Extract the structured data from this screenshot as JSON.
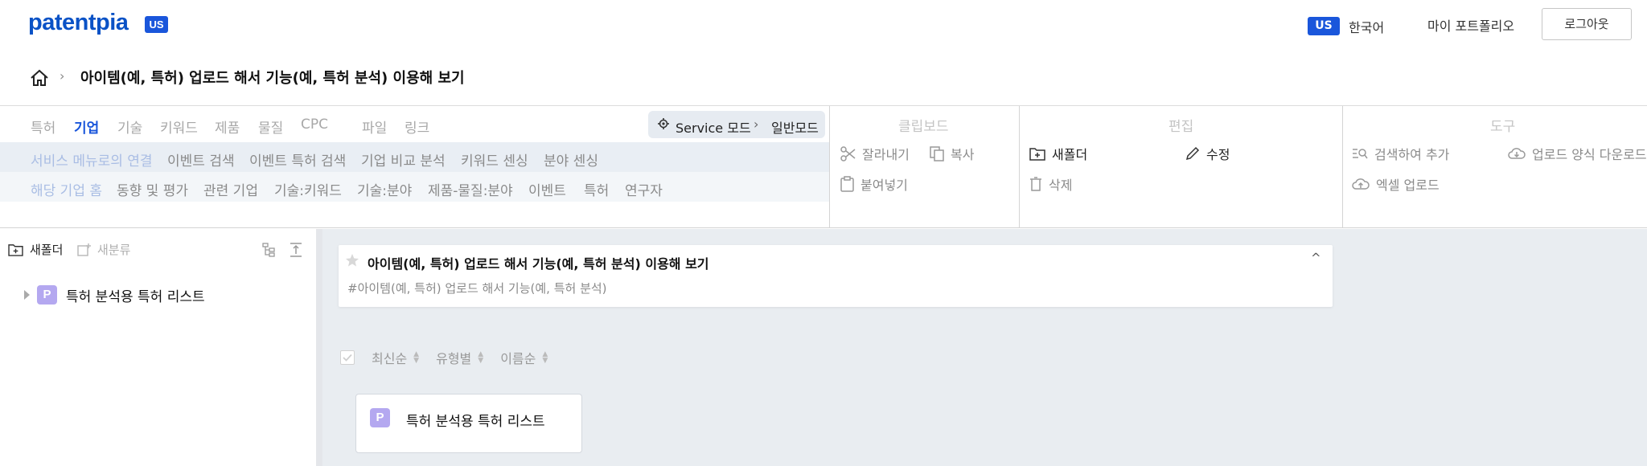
{
  "header": {
    "logo": "patentpia",
    "logo_badge": "US",
    "lang_badge": "US",
    "lang_label": "한국어",
    "portfolio": "마이 포트폴리오",
    "logout": "로그아웃"
  },
  "breadcrumb": {
    "title": "아이템(예, 특허) 업로드 해서 기능(예, 특허 분석) 이용해 보기"
  },
  "ribbon": {
    "categories": [
      "특허",
      "기업",
      "기술",
      "키워드",
      "제품",
      "물질",
      "CPC",
      "파일",
      "링크"
    ],
    "mode": {
      "service": "Service 모드",
      "normal": "일반모드"
    },
    "row2": [
      "서비스 메뉴로의 연결",
      "이벤트 검색",
      "이벤트 특허 검색",
      "기업 비교 분석",
      "키워드 센싱",
      "분야 센싱"
    ],
    "row3": [
      "해당 기업 홈",
      "동향 및 평가",
      "관련 기업",
      "기술:키워드",
      "기술:분야",
      "제품-물질:분야",
      "이벤트",
      "특허",
      "연구자"
    ],
    "clipboard": {
      "title": "클립보드",
      "cut": "잘라내기",
      "copy": "복사",
      "paste": "붙여넣기"
    },
    "edit": {
      "title": "편집",
      "new_folder": "새폴더",
      "modify": "수정",
      "delete": "삭제"
    },
    "tools": {
      "title": "도구",
      "search_add": "검색하여 추가",
      "download_form": "업로드 양식 다운로드",
      "excel_upload": "엑셀 업로드"
    }
  },
  "left_panel": {
    "new_folder": "새폴더",
    "new_category": "새분류",
    "tree": [
      {
        "badge": "P",
        "label": "특허 분석용 특허 리스트"
      }
    ]
  },
  "main": {
    "card_title": "아이템(예, 특허) 업로드 해서 기능(예, 특허 분석) 이용해 보기",
    "card_tags": "#아이템(예, 특허) 업로드 해서 기능(예, 특허 분석)",
    "sort": [
      "최신순",
      "유형별",
      "이름순"
    ],
    "items": [
      {
        "badge": "P",
        "label": "특허 분석용 특허 리스트"
      }
    ]
  }
}
